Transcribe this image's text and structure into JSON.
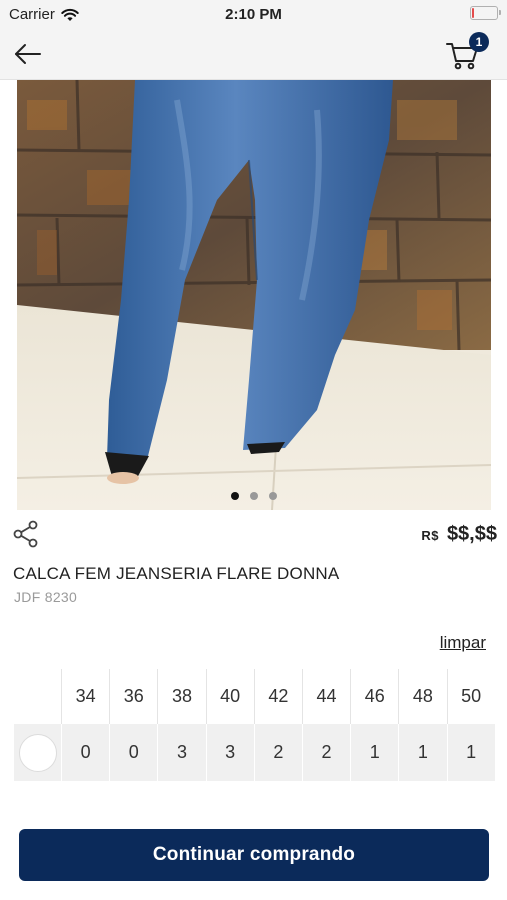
{
  "status_bar": {
    "carrier": "Carrier",
    "time": "2:10 PM",
    "battery_level": 0.1,
    "battery_color": "#e34b4b"
  },
  "nav": {
    "back_icon": "arrow-left-icon",
    "cart_icon": "cart-icon",
    "cart_count": "1"
  },
  "product": {
    "image_count": 3,
    "active_image": 1,
    "price_currency": "R$",
    "price_value": "$$,$$",
    "name": "CALCA FEM JEANSERIA FLARE DONNA",
    "code": "JDF 8230",
    "share_icon": "share-icon"
  },
  "size_grid": {
    "clear_label": "limpar",
    "sizes": [
      "34",
      "36",
      "38",
      "40",
      "42",
      "44",
      "46",
      "48",
      "50"
    ],
    "stock": [
      "0",
      "0",
      "3",
      "3",
      "2",
      "2",
      "1",
      "1",
      "1"
    ]
  },
  "actions": {
    "continue_label": "Continuar comprando"
  },
  "colors": {
    "brand": "#0b2a5a",
    "bar_background": "#f4f4f4",
    "grid_row": "#f0f0f0"
  }
}
